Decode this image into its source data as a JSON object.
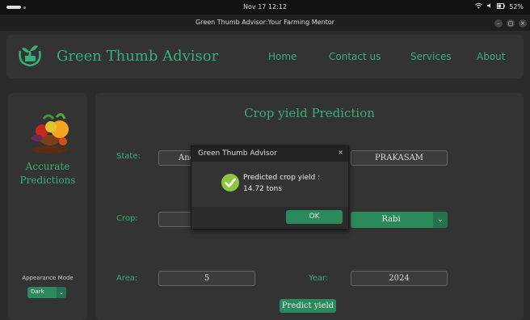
{
  "system_bar": {
    "clock": "Nov 17  12:12",
    "battery": "52%"
  },
  "window": {
    "title": "Green Thumb Advisor:Your Farming Mentor"
  },
  "header": {
    "brand": "Green Thumb Advisor",
    "nav": [
      "Home",
      "Contact us",
      "Services",
      "About"
    ]
  },
  "sidebar": {
    "tagline_line1": "Accurate",
    "tagline_line2": "Predictions",
    "appearance_label": "Appearance Mode",
    "appearance_value": "Dark"
  },
  "form": {
    "title": "Crop yield Prediction",
    "state_label": "State:",
    "state_value": "And",
    "district_value": "PRAKASAM",
    "crop_label": "Crop:",
    "crop_value": "",
    "season_value": "Rabi",
    "area_label": "Area:",
    "area_value": "5",
    "year_label": "Year:",
    "year_value": "2024",
    "predict_button": "Predict yield"
  },
  "dialog": {
    "title": "Green Thumb Advisor",
    "message_line1": "Predicted crop yield :",
    "message_line2": "14.72 tons",
    "ok_button": "OK"
  },
  "colors": {
    "accent": "#35b07a",
    "button": "#2a8a5c",
    "panel": "#333333",
    "background": "#2b2b2b"
  }
}
